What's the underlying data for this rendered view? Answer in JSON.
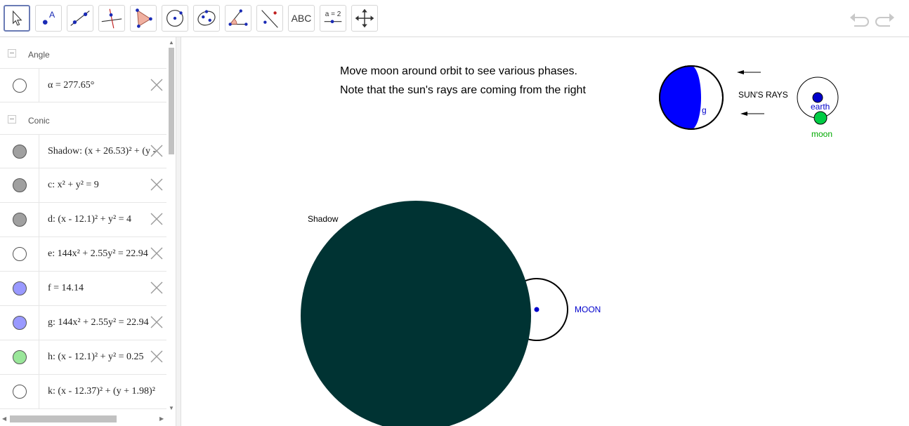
{
  "toolbar": {
    "tools": [
      {
        "name": "move-tool"
      },
      {
        "name": "point-tool",
        "label": "A"
      },
      {
        "name": "line-tool"
      },
      {
        "name": "perpendicular-tool"
      },
      {
        "name": "polygon-tool"
      },
      {
        "name": "circle-tool"
      },
      {
        "name": "ellipse-tool"
      },
      {
        "name": "angle-tool"
      },
      {
        "name": "reflect-tool"
      },
      {
        "name": "text-tool",
        "label": "ABC"
      },
      {
        "name": "slider-tool",
        "label": "a = 2"
      },
      {
        "name": "move-graphics-tool"
      }
    ]
  },
  "algebra": {
    "groups": [
      {
        "name": "Angle",
        "items": [
          {
            "text": "α = 277.65°",
            "color": "#ffffff"
          }
        ]
      },
      {
        "name": "Conic",
        "items": [
          {
            "text": "Shadow: (x + 26.53)² + (y -",
            "color": "#a0a0a0"
          },
          {
            "text": "c: x² + y² = 9",
            "color": "#a0a0a0"
          },
          {
            "text": "d: (x - 12.1)² + y² = 4",
            "color": "#a0a0a0"
          },
          {
            "text": "e: 144x² + 2.55y² = 22.94",
            "color": "#ffffff"
          },
          {
            "text": "f = 14.14",
            "color": "#9999ff"
          },
          {
            "text": "g: 144x² + 2.55y² = 22.94",
            "color": "#9999ff"
          },
          {
            "text": "h: (x - 12.1)² + y² = 0.25",
            "color": "#99e699"
          },
          {
            "text": "k: (x - 12.37)² + (y + 1.98)²",
            "color": "#ffffff"
          }
        ]
      }
    ]
  },
  "graphics": {
    "instruction_line1": "Move moon around orbit to see various phases.",
    "instruction_line2": "Note that the sun's rays are coming from the right",
    "shadow_label": "Shadow",
    "moon_label": "MOON",
    "suns_rays_label": "SUN'S RAYS",
    "phase_label": "g",
    "earth_label": "earth",
    "small_moon_label": "moon",
    "colors": {
      "shadow": "#003333",
      "phase_blue": "#0000ff",
      "earth_label": "#0000cc",
      "moon_green": "#00cc44",
      "moon_label": "#0000cc",
      "small_moon_label": "#00aa00"
    }
  }
}
